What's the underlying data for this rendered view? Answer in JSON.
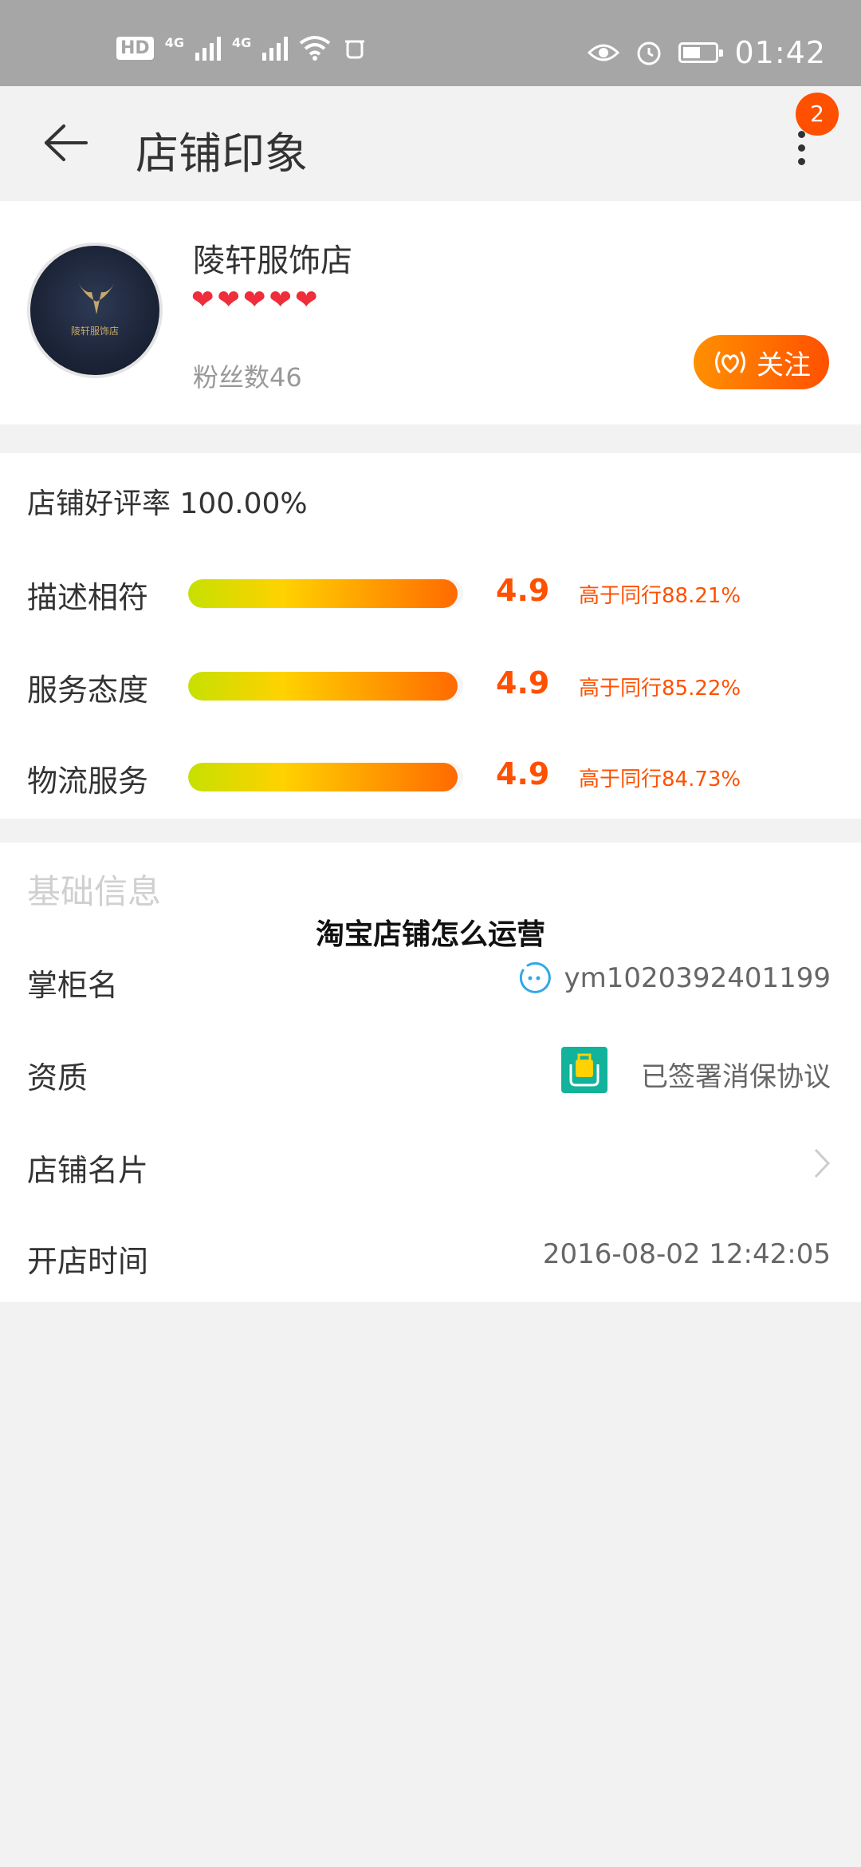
{
  "status_bar": {
    "hd_label": "HD",
    "net1": "4G",
    "net2": "4G",
    "time": "01:42",
    "battery_level": 0.55
  },
  "header": {
    "title": "店铺印象",
    "notification_count": "2"
  },
  "shop": {
    "name": "陵轩服饰店",
    "hearts": 5,
    "fans": "粉丝数46",
    "follow_label": "关注",
    "avatar_text": "陵轩服饰店"
  },
  "rating": {
    "title": "店铺好评率 100.00%",
    "items": [
      {
        "label": "描述相符",
        "score": "4.9",
        "compare": "高于同行88.21%",
        "level": 0.98
      },
      {
        "label": "服务态度",
        "score": "4.9",
        "compare": "高于同行85.22%",
        "level": 0.98
      },
      {
        "label": "物流服务",
        "score": "4.9",
        "compare": "高于同行84.73%",
        "level": 0.98
      }
    ]
  },
  "info": {
    "title": "基础信息",
    "rows": [
      {
        "label": "掌柜名",
        "value": "ym1020392401199"
      },
      {
        "label": "资质",
        "value": "已签署消保协议"
      },
      {
        "label": "店铺名片",
        "value": ""
      },
      {
        "label": "开店时间",
        "value": "2016-08-02 12:42:05"
      }
    ]
  },
  "overlay": {
    "title": "淘宝店铺怎么运营"
  },
  "colors": {
    "accent": "#ff5000",
    "status_bar": "#a6a6a6",
    "heart": "#ef2d3b",
    "qualification_icon": "#12b39a"
  }
}
